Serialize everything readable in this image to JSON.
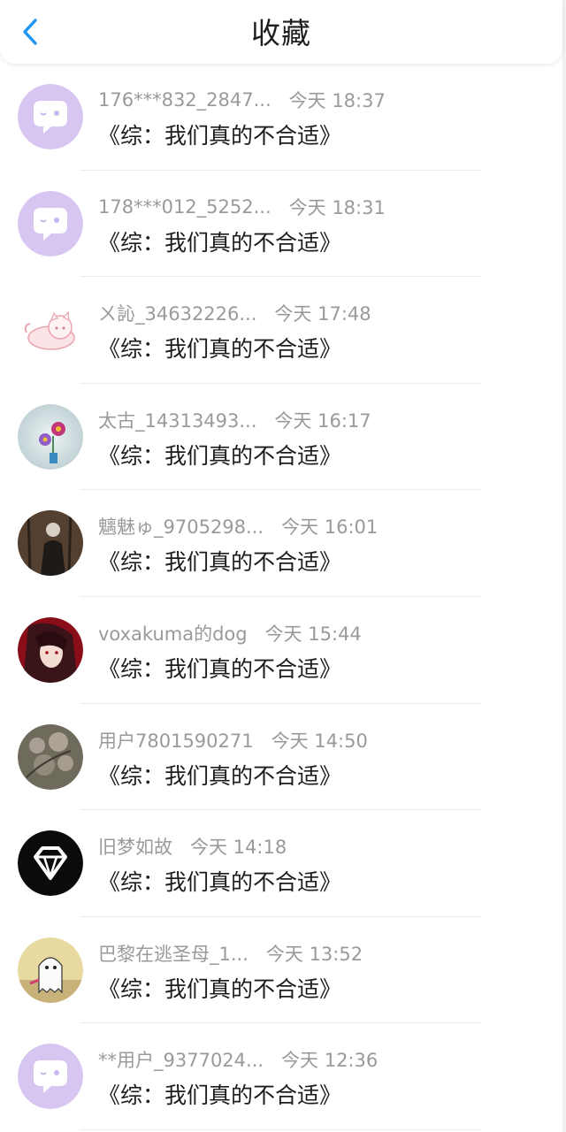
{
  "header": {
    "title": "收藏",
    "back_icon": "chevron-left-icon",
    "accent": "#2196f3"
  },
  "items": [
    {
      "username": "176***832_2847...",
      "time": "今天 18:37",
      "book": "《综：我们真的不合适》",
      "avatar": "default-purple"
    },
    {
      "username": "178***012_5252...",
      "time": "今天 18:31",
      "book": "《综：我们真的不合适》",
      "avatar": "default-purple"
    },
    {
      "username": "ㄨ訫_34632226...",
      "time": "今天 17:48",
      "book": "《综：我们真的不合适》",
      "avatar": "pink-cat"
    },
    {
      "username": "太古_14313493...",
      "time": "今天 16:17",
      "book": "《综：我们真的不合适》",
      "avatar": "flowers"
    },
    {
      "username": "魑魅ゅ_9705298...",
      "time": "今天 16:01",
      "book": "《综：我们真的不合适》",
      "avatar": "dark-figure"
    },
    {
      "username": "voxakuma的dog",
      "time": "今天 15:44",
      "book": "《综：我们真的不合适》",
      "avatar": "anime-red"
    },
    {
      "username": "用户7801590271",
      "time": "今天 14:50",
      "book": "《综：我们真的不合适》",
      "avatar": "blossom"
    },
    {
      "username": "旧梦如故",
      "time": "今天 14:18",
      "book": "《综：我们真的不合适》",
      "avatar": "diamond"
    },
    {
      "username": "巴黎在逃圣母_1...",
      "time": "今天 13:52",
      "book": "《综：我们真的不合适》",
      "avatar": "ghost"
    },
    {
      "username": "**用户_9377024...",
      "time": "今天 12:36",
      "book": "《综：我们真的不合适》",
      "avatar": "default-purple"
    }
  ]
}
